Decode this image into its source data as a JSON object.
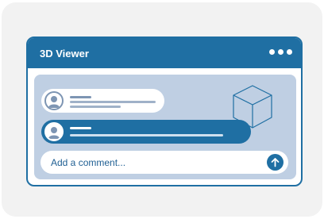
{
  "window": {
    "title": "3D Viewer"
  },
  "comment_input": {
    "placeholder": "Add a comment..."
  },
  "icons": {
    "menu": "more-dots-icon",
    "cube": "cube-icon",
    "send": "arrow-up-icon",
    "avatar": "user-avatar-icon"
  },
  "colors": {
    "accent": "#1f6fa3",
    "panel": "#bfcfe3",
    "background": "#f2f2f2"
  }
}
